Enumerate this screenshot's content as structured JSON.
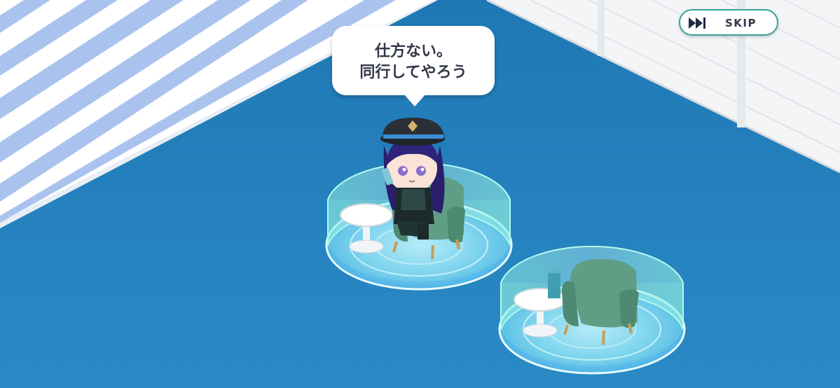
{
  "speech_bubble": {
    "line1": "仕方ない。",
    "line2": "同行してやろう"
  },
  "skip_button": {
    "label": "SKIP",
    "icon": "fast-forward-icon"
  },
  "colors": {
    "floor": "#2a8ac6",
    "accent": "#3aa39a",
    "text": "#33374a",
    "window_stripe": "#aac3ee"
  }
}
